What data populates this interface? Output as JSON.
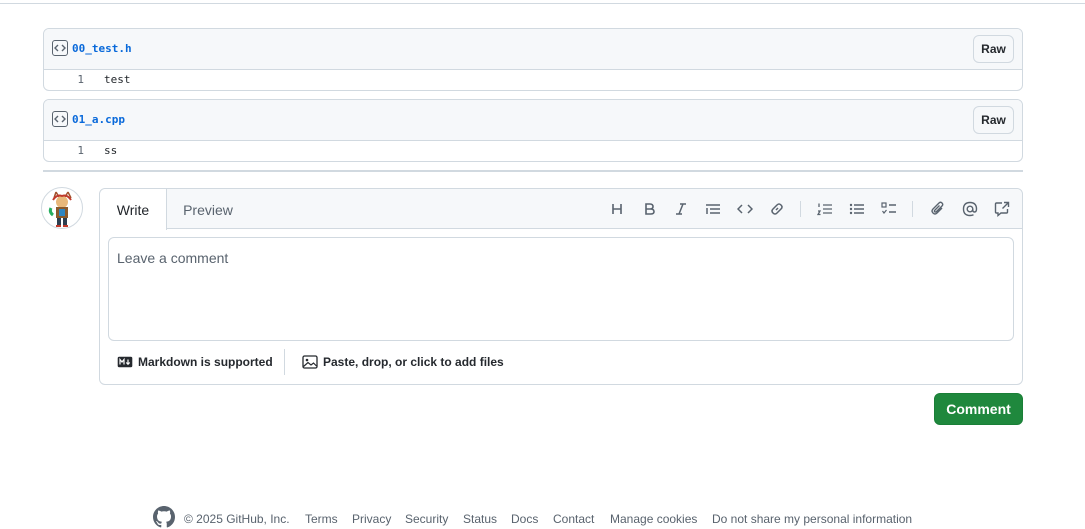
{
  "files": [
    {
      "name": "00_test.h",
      "raw_label": "Raw",
      "lines": [
        {
          "num": "1",
          "text": "test"
        }
      ]
    },
    {
      "name": "01_a.cpp",
      "raw_label": "Raw",
      "lines": [
        {
          "num": "1",
          "text": "ss"
        }
      ]
    }
  ],
  "comment": {
    "tabs": {
      "write": "Write",
      "preview": "Preview"
    },
    "toolbar_icons": [
      "heading-icon",
      "bold-icon",
      "italic-icon",
      "quote-icon",
      "code-icon",
      "link-icon",
      "numbered-list-icon",
      "unordered-list-icon",
      "task-list-icon",
      "attach-icon",
      "mention-icon",
      "reference-icon"
    ],
    "placeholder": "Leave a comment",
    "markdown_note": "Markdown is supported",
    "attach_note": "Paste, drop, or click to add files",
    "submit_label": "Comment"
  },
  "footer": {
    "copyright": "© 2025 GitHub, Inc.",
    "links": [
      "Terms",
      "Privacy",
      "Security",
      "Status",
      "Docs",
      "Contact",
      "Manage cookies",
      "Do not share my personal information"
    ]
  },
  "colors": {
    "accent": "#0969da",
    "primary_button": "#1f883d",
    "border": "#d1d9e0",
    "muted": "#59636e"
  }
}
